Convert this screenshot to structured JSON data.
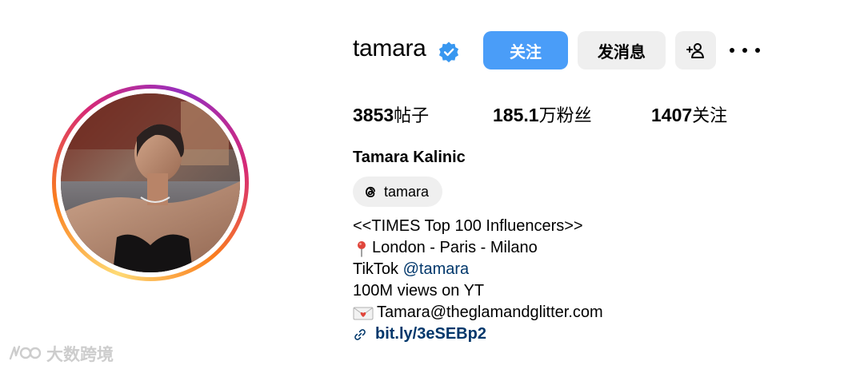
{
  "profile": {
    "username": "tamara",
    "full_name": "Tamara Kalinic",
    "verified": true
  },
  "actions": {
    "follow_label": "关注",
    "message_label": "发消息",
    "add_user_icon": "add-user-icon",
    "more_icon": "more-options-icon"
  },
  "stats": {
    "posts": {
      "value": "3853",
      "unit": "帖子"
    },
    "followers": {
      "value": "185.1",
      "unit": "万粉丝"
    },
    "following": {
      "value": "1407",
      "unit": "关注"
    }
  },
  "threads": {
    "icon": "threads-icon",
    "handle": "tamara"
  },
  "bio": {
    "line1": "<<TIMES Top 100 Influencers>>",
    "line2": "London - Paris - Milano",
    "line3_prefix": "TikTok ",
    "line3_link": "@tamara",
    "line4": "100M views on YT",
    "line5": "Tamara@theglamandglitter.com",
    "url": "bit.ly/3eSEBp2"
  },
  "colors": {
    "follow_button": "#4a9df8",
    "secondary_button": "#efefef",
    "verified_badge": "#3897f0",
    "link": "#00376b",
    "story_ring": [
      "#feda75",
      "#fa7e1e",
      "#d62976",
      "#962fbf"
    ]
  },
  "watermark": {
    "text": "大数跨境"
  }
}
